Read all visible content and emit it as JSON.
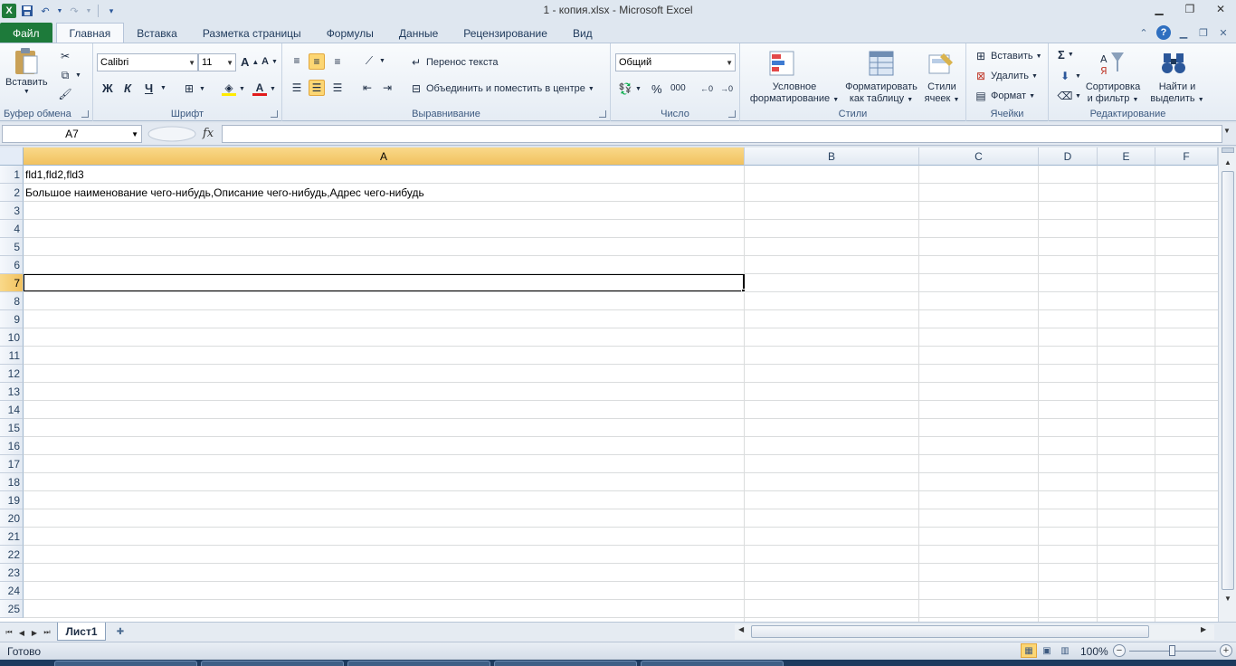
{
  "window": {
    "title": "1 - копия.xlsx  -  Microsoft Excel",
    "app_logo_letter": "X"
  },
  "tabs": [
    {
      "label": "Файл"
    },
    {
      "label": "Главная"
    },
    {
      "label": "Вставка"
    },
    {
      "label": "Разметка страницы"
    },
    {
      "label": "Формулы"
    },
    {
      "label": "Данные"
    },
    {
      "label": "Рецензирование"
    },
    {
      "label": "Вид"
    }
  ],
  "ribbon": {
    "clipboard": {
      "label": "Буфер обмена",
      "paste": "Вставить"
    },
    "font": {
      "label": "Шрифт",
      "font_name": "Calibri",
      "font_size": "11",
      "bold": "Ж",
      "italic": "К",
      "underline": "Ч"
    },
    "alignment": {
      "label": "Выравнивание",
      "wrap": "Перенос текста",
      "merge": "Объединить и поместить в центре"
    },
    "number": {
      "label": "Число",
      "format": "Общий",
      "percent": "%",
      "thousands": "000"
    },
    "styles": {
      "label": "Стили",
      "conditional_1": "Условное",
      "conditional_2": "форматирование",
      "table_1": "Форматировать",
      "table_2": "как таблицу",
      "cell_1": "Стили",
      "cell_2": "ячеек"
    },
    "cells": {
      "label": "Ячейки",
      "insert": "Вставить",
      "delete": "Удалить",
      "format": "Формат"
    },
    "editing": {
      "label": "Редактирование",
      "sigma": "Σ",
      "sort_1": "Сортировка",
      "sort_2": "и фильтр",
      "find_1": "Найти и",
      "find_2": "выделить"
    }
  },
  "formula_bar": {
    "name_box": "A7",
    "fx": "fx",
    "value": ""
  },
  "grid": {
    "columns": [
      "A",
      "B",
      "C",
      "D",
      "E",
      "F"
    ],
    "rows": [
      "1",
      "2",
      "3",
      "4",
      "5",
      "6",
      "7",
      "8",
      "9",
      "10",
      "11",
      "12",
      "13",
      "14",
      "15",
      "16",
      "17",
      "18",
      "19",
      "20",
      "21",
      "22",
      "23",
      "24",
      "25"
    ],
    "cells": {
      "A1": "fld1,fld2,fld3",
      "A2": "Большое наименование чего-нибудь,Описание чего-нибудь,Адрес чего-нибудь"
    },
    "selected": "A7"
  },
  "sheets": [
    {
      "label": "Лист1"
    }
  ],
  "status": {
    "text": "Готово",
    "zoom": "100%",
    "zoom_minus": "−",
    "zoom_plus": "+"
  },
  "colors": {
    "file_tab": "#1d7a3a",
    "selection_header": "#f1c15e",
    "accent": "#2b579a"
  }
}
